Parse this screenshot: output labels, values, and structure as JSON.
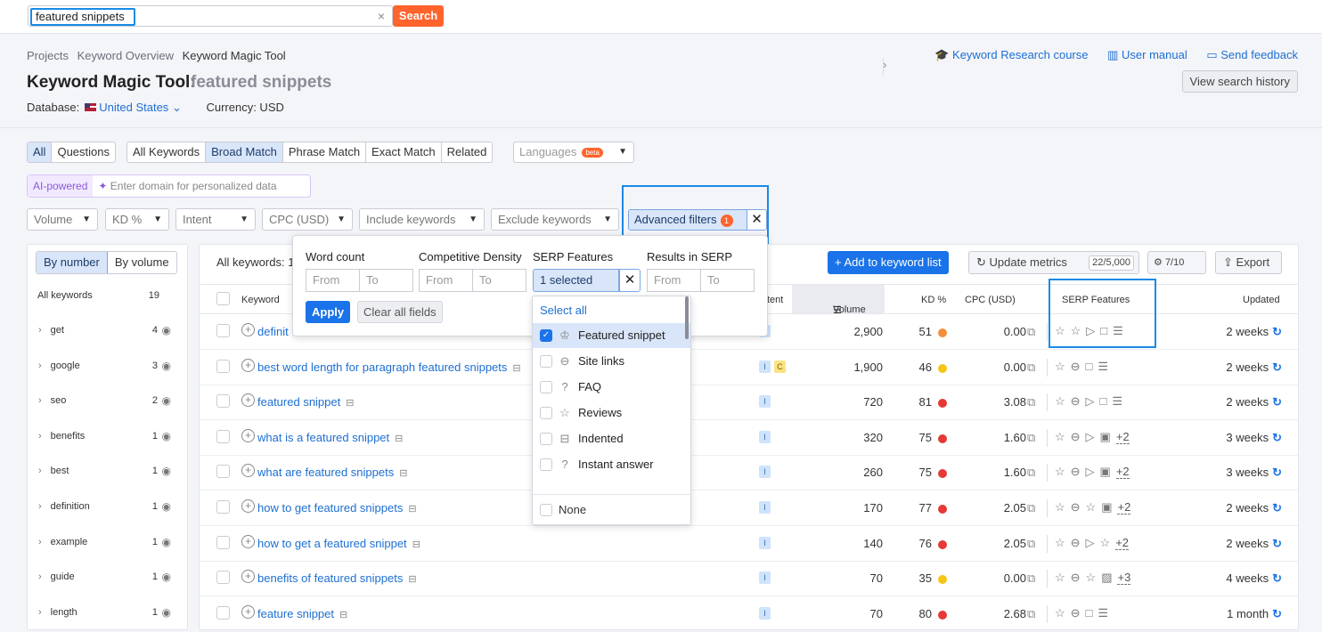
{
  "search": {
    "value": "featured snippets",
    "clear": "×",
    "button": "Search"
  },
  "breadcrumbs": [
    "Projects",
    "Keyword Overview",
    "Keyword Magic Tool"
  ],
  "links": {
    "course": "Keyword Research course",
    "manual": "User manual",
    "feedback": "Send feedback"
  },
  "title": {
    "main": "Keyword Magic Tool:",
    "keyword": "featured snippets",
    "history": "View search history"
  },
  "database": {
    "label": "Database:",
    "country": "United States",
    "currency": "Currency: USD"
  },
  "tabs1": [
    "All",
    "Questions"
  ],
  "tabs2": [
    "All Keywords",
    "Broad Match",
    "Phrase Match",
    "Exact Match",
    "Related"
  ],
  "languages": {
    "label": "Languages",
    "beta": "beta"
  },
  "ai": {
    "tag": "AI-powered",
    "placeholder": "Enter domain for personalized data"
  },
  "filters": [
    "Volume",
    "KD %",
    "Intent",
    "CPC (USD)",
    "Include keywords",
    "Exclude keywords"
  ],
  "advanced": {
    "label": "Advanced filters",
    "count": "1"
  },
  "popup": {
    "word_count": "Word count",
    "comp_density": "Competitive Density",
    "serp": "SERP Features",
    "results": "Results in SERP",
    "from": "From",
    "to": "To",
    "selected": "1 selected",
    "apply": "Apply",
    "clear": "Clear all fields"
  },
  "dropdown": {
    "select_all": "Select all",
    "items": [
      "Featured snippet",
      "Site links",
      "FAQ",
      "Reviews",
      "Indented",
      "Instant answer"
    ],
    "none": "None"
  },
  "left": {
    "by_number": "By number",
    "by_volume": "By volume",
    "all": "All keywords",
    "all_count": "19",
    "groups": [
      {
        "name": "get",
        "n": "4"
      },
      {
        "name": "google",
        "n": "3"
      },
      {
        "name": "seo",
        "n": "2"
      },
      {
        "name": "benefits",
        "n": "1"
      },
      {
        "name": "best",
        "n": "1"
      },
      {
        "name": "definition",
        "n": "1"
      },
      {
        "name": "example",
        "n": "1"
      },
      {
        "name": "guide",
        "n": "1"
      },
      {
        "name": "length",
        "n": "1"
      }
    ]
  },
  "toolbar": {
    "all": "All keywords: 1",
    "add": "Add to keyword list",
    "update": "Update metrics",
    "update_count": "22/5,000",
    "settings": "7/10",
    "export": "Export"
  },
  "columns": {
    "keyword": "Keyword",
    "intent": "tent",
    "volume": "Volume",
    "kd": "KD %",
    "cpc": "CPC (USD)",
    "serp": "SERP Features",
    "updated": "Updated"
  },
  "rows": [
    {
      "kw": "definit",
      "intent": [
        "I"
      ],
      "vol": "2,900",
      "kd": "51",
      "color": "#f28f3b",
      "cpc": "0.00",
      "serp": "☆☆▷□☰",
      "upd": "2 weeks"
    },
    {
      "kw": "best word length for paragraph featured snippets",
      "intent": [
        "I",
        "C"
      ],
      "vol": "1,900",
      "kd": "46",
      "color": "#f5c518",
      "cpc": "0.00",
      "serp": "☆⊖□☰",
      "upd": "2 weeks"
    },
    {
      "kw": "featured snippet",
      "intent": [
        "I"
      ],
      "vol": "720",
      "kd": "81",
      "color": "#e53935",
      "cpc": "3.08",
      "serp": "☆⊖▷□☰",
      "upd": "2 weeks"
    },
    {
      "kw": "what is a featured snippet",
      "intent": [
        "I"
      ],
      "vol": "320",
      "kd": "75",
      "color": "#e53935",
      "cpc": "1.60",
      "serp": "☆⊖▷▣",
      "more": "+2",
      "upd": "3 weeks"
    },
    {
      "kw": "what are featured snippets",
      "intent": [
        "I"
      ],
      "vol": "260",
      "kd": "75",
      "color": "#e53935",
      "cpc": "1.60",
      "serp": "☆⊖▷▣",
      "more": "+2",
      "upd": "3 weeks"
    },
    {
      "kw": "how to get featured snippets",
      "intent": [
        "I"
      ],
      "vol": "170",
      "kd": "77",
      "color": "#e53935",
      "cpc": "2.05",
      "serp": "☆⊖☆▣",
      "more": "+2",
      "upd": "2 weeks"
    },
    {
      "kw": "how to get a featured snippet",
      "intent": [
        "I"
      ],
      "vol": "140",
      "kd": "76",
      "color": "#e53935",
      "cpc": "2.05",
      "serp": "☆⊖▷☆",
      "more": "+2",
      "upd": "2 weeks"
    },
    {
      "kw": "benefits of featured snippets",
      "intent": [
        "I"
      ],
      "vol": "70",
      "kd": "35",
      "color": "#f5c518",
      "cpc": "0.00",
      "serp": "☆⊖☆▨",
      "more": "+3",
      "upd": "4 weeks"
    },
    {
      "kw": "feature snippet",
      "intent": [
        "I"
      ],
      "vol": "70",
      "kd": "80",
      "color": "#e53935",
      "cpc": "2.68",
      "serp": "☆⊖□☰",
      "upd": "1 month"
    }
  ]
}
